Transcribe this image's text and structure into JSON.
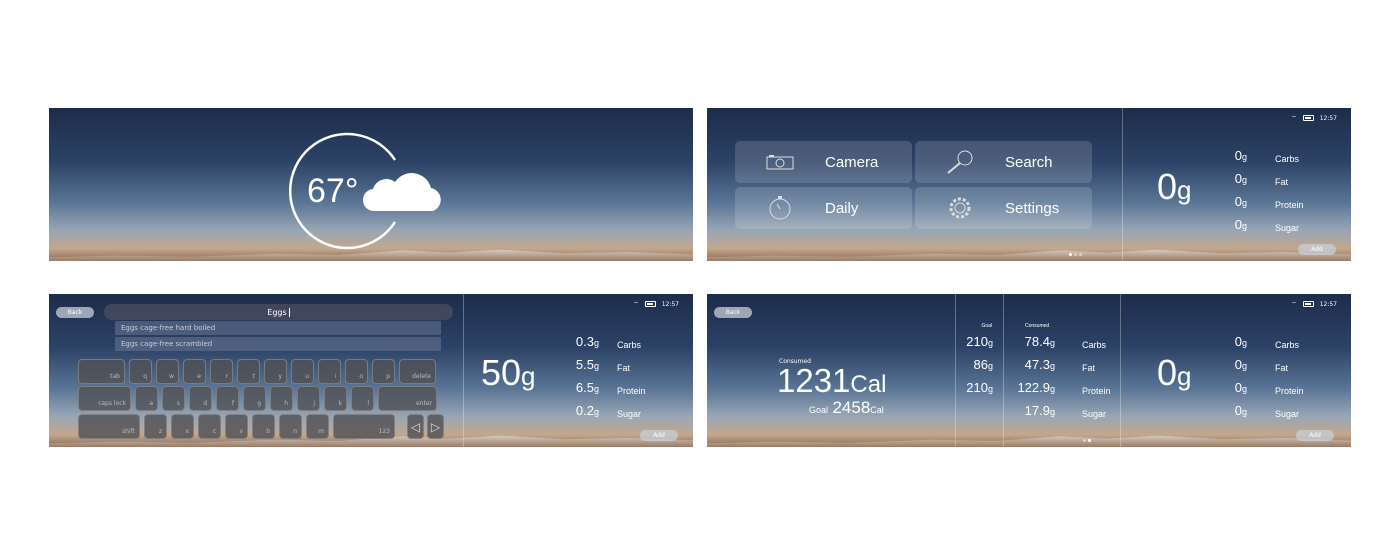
{
  "status": {
    "time": "12:57",
    "wifi_icon": "wifi-icon",
    "battery_icon": "battery-icon"
  },
  "weather": {
    "temperature": "67°",
    "icon": "cloud-icon"
  },
  "menu": {
    "items": [
      {
        "label": "Camera",
        "icon": "camera-icon"
      },
      {
        "label": "Search",
        "icon": "magnifier-icon"
      },
      {
        "label": "Daily",
        "icon": "stopwatch-icon"
      },
      {
        "label": "Settings",
        "icon": "gear-icon"
      }
    ]
  },
  "scale_empty": {
    "total": "0",
    "unit": "g",
    "rows": [
      {
        "value": "0",
        "unit": "g",
        "label": "Carbs"
      },
      {
        "value": "0",
        "unit": "g",
        "label": "Fat"
      },
      {
        "value": "0",
        "unit": "g",
        "label": "Protein"
      },
      {
        "value": "0",
        "unit": "g",
        "label": "Sugar"
      }
    ],
    "add_label": "Add"
  },
  "search": {
    "back_label": "Back",
    "query": "Eggs",
    "suggestions": [
      "Eggs cage-free hard boiled",
      "Eggs cage-free scrambled"
    ],
    "keys": [
      [
        "tab",
        "q",
        "w",
        "e",
        "r",
        "t",
        "y",
        "u",
        "i",
        "o",
        "p",
        "delete"
      ],
      [
        "caps lock",
        "a",
        "s",
        "d",
        "f",
        "g",
        "h",
        "j",
        "k",
        "l",
        "enter"
      ],
      [
        "shift",
        "z",
        "x",
        "c",
        "v",
        "b",
        "n",
        "m",
        "123"
      ]
    ]
  },
  "scale_eggs": {
    "total": "50",
    "unit": "g",
    "rows": [
      {
        "value": "0.3",
        "unit": "g",
        "label": "Carbs"
      },
      {
        "value": "5.5",
        "unit": "g",
        "label": "Fat"
      },
      {
        "value": "6.5",
        "unit": "g",
        "label": "Protein"
      },
      {
        "value": "0.2",
        "unit": "g",
        "label": "Sugar"
      }
    ],
    "add_label": "Add"
  },
  "daily": {
    "back_label": "Back",
    "consumed_label": "Consumed",
    "consumed": "1231",
    "cal_unit": "Cal",
    "goal_label": "Goal",
    "goal": "2458",
    "goal_header": "Goal",
    "consumed_header": "Consumed",
    "rows": [
      {
        "goal": "210",
        "consumed": "78.4",
        "label": "Carbs"
      },
      {
        "goal": "86",
        "consumed": "47.3",
        "label": "Fat"
      },
      {
        "goal": "210",
        "consumed": "122.9",
        "label": "Protein"
      },
      {
        "goal": "",
        "consumed": "17.9",
        "label": "Sugar"
      }
    ],
    "unit": "g"
  }
}
